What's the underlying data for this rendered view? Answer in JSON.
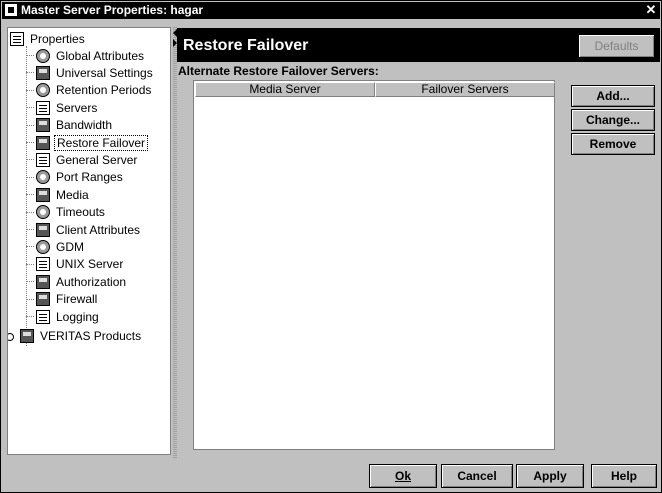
{
  "window": {
    "title": "Master Server Properties: hagar",
    "close_glyph": "✕"
  },
  "tree": {
    "root_label": "Properties",
    "items": [
      {
        "label": "Global Attributes",
        "icon": "globe-icon"
      },
      {
        "label": "Universal Settings",
        "icon": "settings-icon"
      },
      {
        "label": "Retention Periods",
        "icon": "retention-icon"
      },
      {
        "label": "Servers",
        "icon": "servers-icon"
      },
      {
        "label": "Bandwidth",
        "icon": "bandwidth-icon"
      },
      {
        "label": "Restore Failover",
        "icon": "restore-failover-icon",
        "selected": true
      },
      {
        "label": "General Server",
        "icon": "general-server-icon"
      },
      {
        "label": "Port Ranges",
        "icon": "port-ranges-icon"
      },
      {
        "label": "Media",
        "icon": "media-icon"
      },
      {
        "label": "Timeouts",
        "icon": "timeouts-icon"
      },
      {
        "label": "Client Attributes",
        "icon": "client-attributes-icon"
      },
      {
        "label": "GDM",
        "icon": "gdm-icon"
      },
      {
        "label": "UNIX Server",
        "icon": "unix-server-icon"
      },
      {
        "label": "Authorization",
        "icon": "authorization-icon"
      },
      {
        "label": "Firewall",
        "icon": "firewall-icon"
      },
      {
        "label": "Logging",
        "icon": "logging-icon"
      }
    ],
    "veritas_label": "VERITAS Products"
  },
  "panel": {
    "title": "Restore Failover",
    "defaults_label": "Defaults",
    "caption": "Alternate Restore Failover Servers:",
    "columns": [
      "Media Server",
      "Failover Servers"
    ],
    "rows": [],
    "add_label": "Add...",
    "change_label": "Change...",
    "remove_label": "Remove"
  },
  "footer": {
    "ok_label": "Ok",
    "cancel_label": "Cancel",
    "apply_label": "Apply",
    "help_label": "Help"
  }
}
